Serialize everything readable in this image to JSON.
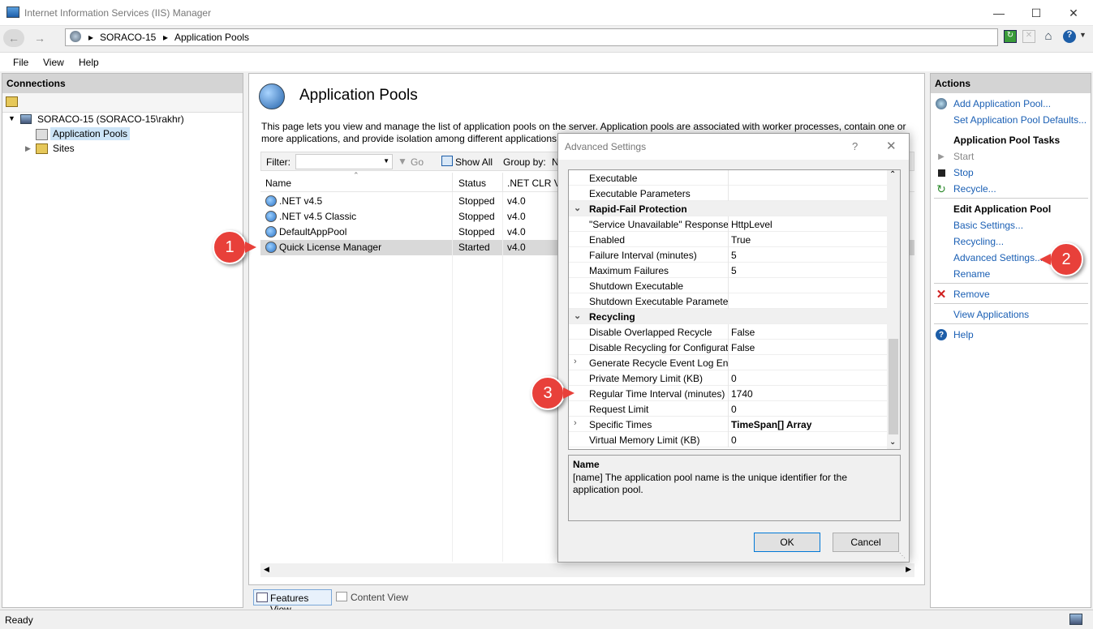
{
  "window": {
    "title": "Internet Information Services (IIS) Manager"
  },
  "address": {
    "crumbs": [
      "SORACO-15",
      "Application Pools"
    ]
  },
  "menu": {
    "file": "File",
    "view": "View",
    "help": "Help"
  },
  "connections": {
    "header": "Connections",
    "server": "SORACO-15 (SORACO-15\\rakhr)",
    "app_pools": "Application Pools",
    "sites": "Sites"
  },
  "center": {
    "title": "Application Pools",
    "description_line1": "This page lets you view and manage the list of application pools on the server. Application pools are associated with worker processes, contain one or",
    "description_line2": "more applications, and provide isolation among different applications",
    "filter_label": "Filter:",
    "go": "Go",
    "show_all": "Show All",
    "group_by": "Group by:",
    "group_by_value": "N",
    "columns": {
      "name": "Name",
      "status": "Status",
      "clr": ".NET CLR V..."
    },
    "rows": [
      {
        "name": ".NET v4.5",
        "status": "Stopped",
        "clr": "v4.0"
      },
      {
        "name": ".NET v4.5 Classic",
        "status": "Stopped",
        "clr": "v4.0"
      },
      {
        "name": "DefaultAppPool",
        "status": "Stopped",
        "clr": "v4.0"
      },
      {
        "name": "Quick License Manager",
        "status": "Started",
        "clr": "v4.0"
      }
    ],
    "features_view": "Features View",
    "content_view": "Content View"
  },
  "dialog": {
    "title": "Advanced Settings",
    "help": "?",
    "rows": [
      {
        "key": "Executable",
        "value": ""
      },
      {
        "key": "Executable Parameters",
        "value": ""
      },
      {
        "key": "Rapid-Fail Protection",
        "value": "",
        "category": true
      },
      {
        "key": "\"Service Unavailable\" Response T",
        "value": "HttpLevel"
      },
      {
        "key": "Enabled",
        "value": "True"
      },
      {
        "key": "Failure Interval (minutes)",
        "value": "5"
      },
      {
        "key": "Maximum Failures",
        "value": "5"
      },
      {
        "key": "Shutdown Executable",
        "value": ""
      },
      {
        "key": "Shutdown Executable Parameter",
        "value": ""
      },
      {
        "key": "Recycling",
        "value": "",
        "category": true
      },
      {
        "key": "Disable Overlapped Recycle",
        "value": "False"
      },
      {
        "key": "Disable Recycling for Configurat",
        "value": "False"
      },
      {
        "key": "Generate Recycle Event Log Entr",
        "value": "",
        "expandable": true
      },
      {
        "key": "Private Memory Limit (KB)",
        "value": "0"
      },
      {
        "key": "Regular Time Interval (minutes)",
        "value": "1740"
      },
      {
        "key": "Request Limit",
        "value": "0"
      },
      {
        "key": "Specific Times",
        "value": "TimeSpan[] Array",
        "expandable": true,
        "bold_value": true
      },
      {
        "key": "Virtual Memory Limit (KB)",
        "value": "0"
      }
    ],
    "desc_title": "Name",
    "desc_text": "[name] The application pool name is the unique identifier for the application pool.",
    "ok": "OK",
    "cancel": "Cancel"
  },
  "actions": {
    "header": "Actions",
    "add_pool": "Add Application Pool...",
    "set_defaults": "Set Application Pool Defaults...",
    "tasks_header": "Application Pool Tasks",
    "start": "Start",
    "stop": "Stop",
    "recycle": "Recycle...",
    "edit_header": "Edit Application Pool",
    "basic_settings": "Basic Settings...",
    "recycling": "Recycling...",
    "advanced_settings": "Advanced Settings...",
    "rename": "Rename",
    "remove": "Remove",
    "view_apps": "View Applications",
    "help": "Help"
  },
  "callouts": {
    "one": "1",
    "two": "2",
    "three": "3"
  },
  "status": {
    "text": "Ready"
  }
}
